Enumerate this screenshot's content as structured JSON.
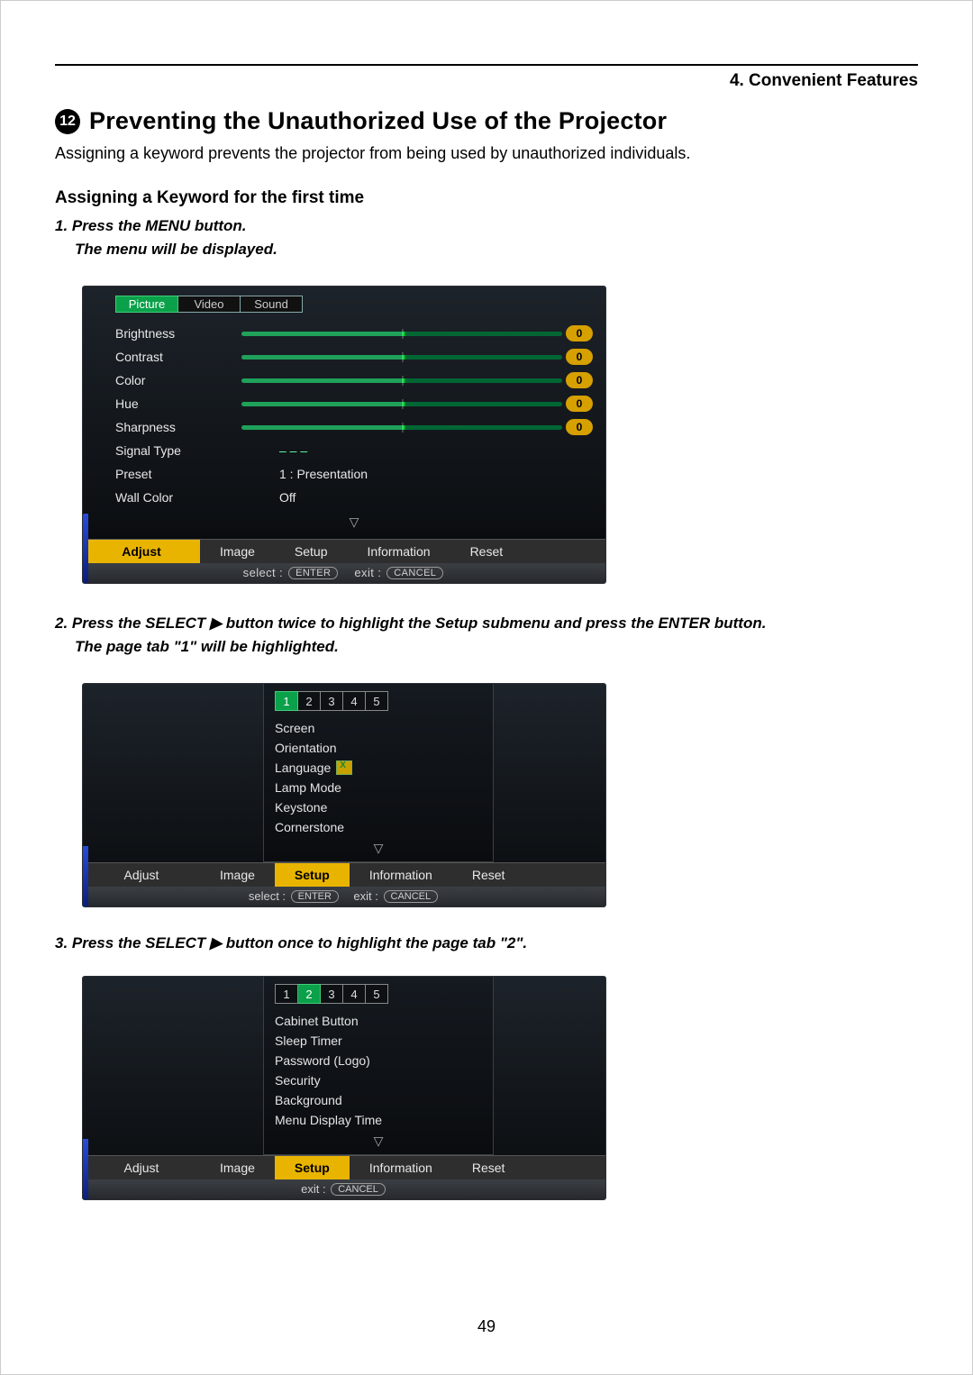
{
  "chapter": "4. Convenient Features",
  "section_number": "12",
  "title": "Preventing the Unauthorized Use of the Projector",
  "intro": "Assigning a keyword prevents the projector from being used by unauthorized individuals.",
  "subhead": "Assigning a Keyword for the first time",
  "step1": "1.  Press the MENU button.",
  "step1_sub": "The menu will be displayed.",
  "step2": "2.  Press the SELECT ▶ button twice to highlight the Setup submenu and press the ENTER button.",
  "step2_sub": "The page tab \"1\" will be highlighted.",
  "step3": "3.  Press the SELECT ▶ button once to highlight the page tab \"2\".",
  "page_number": "49",
  "osd1": {
    "top_tabs": [
      "Picture",
      "Video",
      "Sound"
    ],
    "top_active": 0,
    "rows": [
      {
        "label": "Brightness",
        "slider": true,
        "value": "0"
      },
      {
        "label": "Contrast",
        "slider": true,
        "value": "0"
      },
      {
        "label": "Color",
        "slider": true,
        "value": "0"
      },
      {
        "label": "Hue",
        "slider": true,
        "value": "0"
      },
      {
        "label": "Sharpness",
        "slider": true,
        "value": "0"
      },
      {
        "label": "Signal Type",
        "slider": false,
        "value": "– – –"
      },
      {
        "label": "Preset",
        "slider": false,
        "value": "1 : Presentation"
      },
      {
        "label": "Wall Color",
        "slider": false,
        "value": "Off"
      }
    ],
    "bottom_tabs": [
      "Adjust",
      "Image",
      "Setup",
      "Information",
      "Reset"
    ],
    "bottom_active": 0,
    "status_select": "select :",
    "status_enter": "ENTER",
    "status_exit": "exit :",
    "status_cancel": "CANCEL"
  },
  "osd2": {
    "page_tabs": [
      "1",
      "2",
      "3",
      "4",
      "5"
    ],
    "page_active": 0,
    "items": [
      "Screen",
      "Orientation",
      "Language",
      "Lamp Mode",
      "Keystone",
      "Cornerstone"
    ],
    "lang_index": 2,
    "bottom_tabs": [
      "Adjust",
      "Image",
      "Setup",
      "Information",
      "Reset"
    ],
    "bottom_active": 2,
    "status_select": "select :",
    "status_enter": "ENTER",
    "status_exit": "exit :",
    "status_cancel": "CANCEL"
  },
  "osd3": {
    "page_tabs": [
      "1",
      "2",
      "3",
      "4",
      "5"
    ],
    "page_active": 1,
    "items": [
      "Cabinet Button",
      "Sleep Timer",
      "Password (Logo)",
      "Security",
      "Background",
      "Menu Display Time"
    ],
    "bottom_tabs": [
      "Adjust",
      "Image",
      "Setup",
      "Information",
      "Reset"
    ],
    "bottom_active": 2,
    "status_exit": "exit :",
    "status_cancel": "CANCEL"
  }
}
